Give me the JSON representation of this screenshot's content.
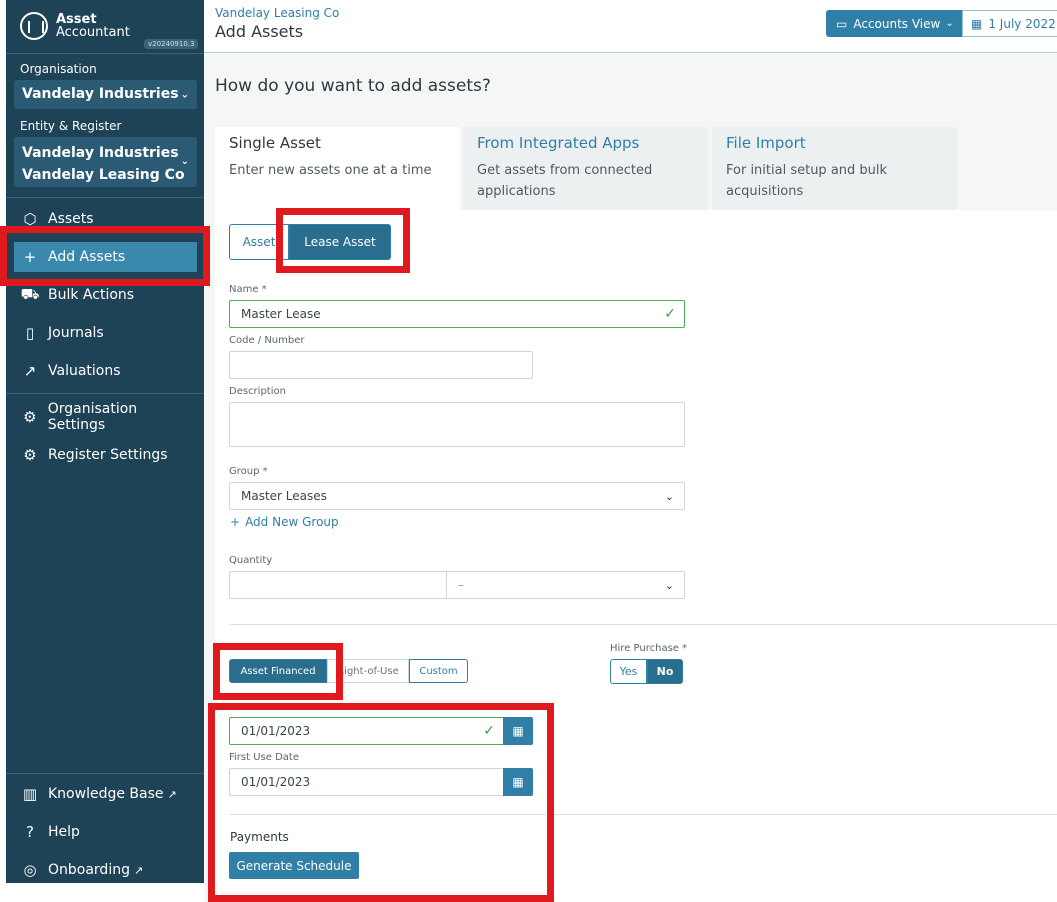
{
  "app": {
    "brand_name": "Asset",
    "brand_sub": "Accountant",
    "version": "v20240910.3"
  },
  "sidebar": {
    "org_label": "Organisation",
    "org_value": "Vandelay Industries",
    "entity_label": "Entity & Register",
    "entity_line1": "Vandelay Industries",
    "entity_line2": "Vandelay Leasing Co",
    "nav": [
      {
        "label": "Assets",
        "icon": "cube-icon"
      },
      {
        "label": "Add Assets",
        "icon": "plus-icon",
        "active": true
      },
      {
        "label": "Bulk Actions",
        "icon": "truck-icon"
      },
      {
        "label": "Journals",
        "icon": "book-icon"
      },
      {
        "label": "Valuations",
        "icon": "trend-icon"
      }
    ],
    "settings": [
      {
        "label": "Organisation Settings",
        "icon": "gear-icon"
      },
      {
        "label": "Register Settings",
        "icon": "gear-icon"
      }
    ],
    "footer": [
      {
        "label": "Knowledge Base",
        "icon": "library-icon",
        "external": true
      },
      {
        "label": "Help",
        "icon": "help-icon"
      },
      {
        "label": "Onboarding",
        "icon": "compass-icon",
        "external": true
      }
    ]
  },
  "header": {
    "breadcrumb": "Vandelay Leasing Co",
    "title": "Add Assets",
    "view_label": "Accounts View",
    "date_label": "1 July 2022"
  },
  "main": {
    "question": "How do you want to add assets?",
    "tabs": [
      {
        "title": "Single Asset",
        "desc": "Enter new assets one at a time"
      },
      {
        "title": "From Integrated Apps",
        "desc": "Get assets from connected applications"
      },
      {
        "title": "File Import",
        "desc": "For initial setup and bulk acquisitions"
      }
    ],
    "asset_type": {
      "asset": "Asset",
      "lease": "Lease Asset"
    },
    "name_label": "Name *",
    "name_value": "Master Lease",
    "code_label": "Code / Number",
    "code_value": "",
    "description_label": "Description",
    "description_value": "",
    "group_label": "Group *",
    "group_value": "Master Leases",
    "add_group": "Add New Group",
    "quantity_label": "Quantity",
    "quantity_value": "",
    "quantity_unit": "–",
    "lease_type": {
      "financed": "Asset Financed",
      "rou": "Right-of-Use",
      "custom": "Custom"
    },
    "hire_purchase_label": "Hire Purchase *",
    "hire_yes": "Yes",
    "hire_no": "No",
    "start_date_value": "01/01/2023",
    "first_use_label": "First Use Date",
    "first_use_value": "01/01/2023",
    "payments_label": "Payments",
    "generate_label": "Generate Schedule"
  },
  "colors": {
    "sidebar": "#1e4256",
    "accent": "#2f7fa6",
    "highlight": "#e0191f",
    "valid": "#3a9b3f"
  }
}
